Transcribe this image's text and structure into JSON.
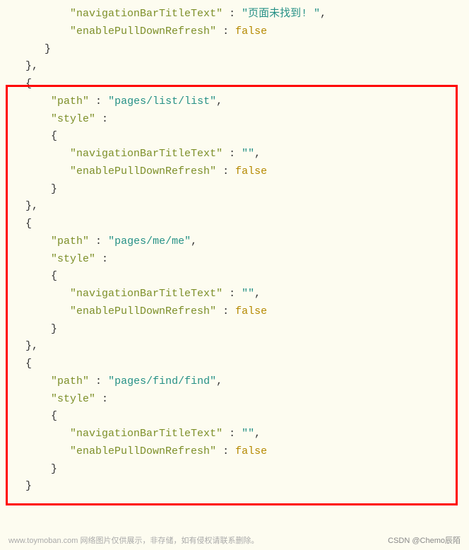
{
  "keys": {
    "navTitle": "\"navigationBarTitleText\"",
    "enablePull": "\"enablePullDownRefresh\"",
    "path": "\"path\"",
    "style": "\"style\""
  },
  "values": {
    "notFound": "\"页面未找到! \"",
    "empty": "\"\"",
    "pathList": "\"pages/list/list\"",
    "pathMe": "\"pages/me/me\"",
    "pathFind": "\"pages/find/find\"",
    "false": "false"
  },
  "punct": {
    "colon": " : ",
    "comma": ",",
    "openBrace": "{",
    "closeBrace": "}",
    "closeBraceComma": "},"
  },
  "indent": {
    "l1": "    ",
    "l2": "           ",
    "l3": "               ",
    "p1": "   ",
    "p2": "       ",
    "p3": "           "
  },
  "footer": {
    "left": "www.toymoban.com 网络图片仅供展示，非存储，如有侵权请联系删除。",
    "right": "CSDN @Chemo辰陌"
  }
}
